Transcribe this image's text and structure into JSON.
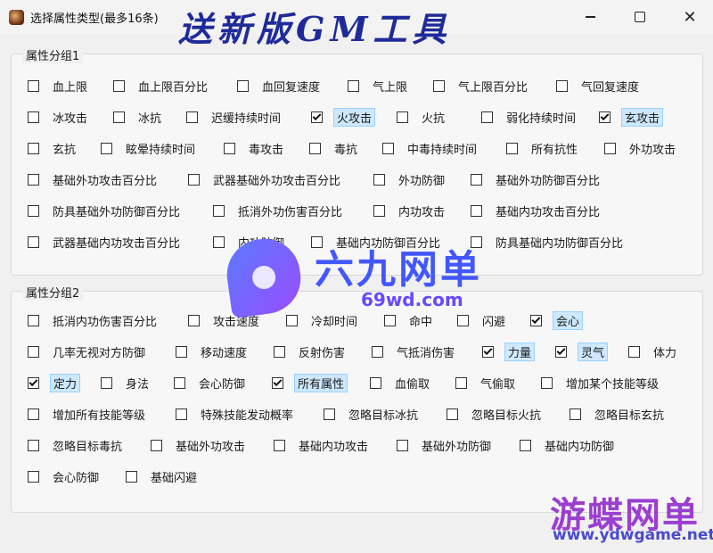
{
  "window": {
    "title": "选择属性类型(最多16条)",
    "banner": "送新版GM工具",
    "controls": {
      "minimize": "minimize-icon",
      "maximize": "maximize-icon",
      "close": "✕"
    }
  },
  "group1": {
    "legend": "属性分组1",
    "items": [
      {
        "label": "血上限",
        "checked": false
      },
      {
        "label": "血上限百分比",
        "checked": false
      },
      {
        "label": "血回复速度",
        "checked": false
      },
      {
        "label": "气上限",
        "checked": false
      },
      {
        "label": "气上限百分比",
        "checked": false
      },
      {
        "label": "气回复速度",
        "checked": false
      },
      {
        "label": "冰攻击",
        "checked": false
      },
      {
        "label": "冰抗",
        "checked": false
      },
      {
        "label": "迟缓持续时间",
        "checked": false
      },
      {
        "label": "火攻击",
        "checked": true
      },
      {
        "label": "火抗",
        "checked": false
      },
      {
        "label": "弱化持续时间",
        "checked": false
      },
      {
        "label": "玄攻击",
        "checked": true
      },
      {
        "label": "玄抗",
        "checked": false
      },
      {
        "label": "眩晕持续时间",
        "checked": false
      },
      {
        "label": "毒攻击",
        "checked": false
      },
      {
        "label": "毒抗",
        "checked": false
      },
      {
        "label": "中毒持续时间",
        "checked": false
      },
      {
        "label": "所有抗性",
        "checked": false
      },
      {
        "label": "外功攻击",
        "checked": false
      },
      {
        "label": "基础外功攻击百分比",
        "checked": false
      },
      {
        "label": "武器基础外功攻击百分比",
        "checked": false
      },
      {
        "label": "外功防御",
        "checked": false
      },
      {
        "label": "基础外功防御百分比",
        "checked": false
      },
      {
        "label": "防具基础外功防御百分比",
        "checked": false
      },
      {
        "label": "抵消外功伤害百分比",
        "checked": false
      },
      {
        "label": "内功攻击",
        "checked": false
      },
      {
        "label": "基础内功攻击百分比",
        "checked": false
      },
      {
        "label": "武器基础内功攻击百分比",
        "checked": false
      },
      {
        "label": "内功防御",
        "checked": false
      },
      {
        "label": "基础内功防御百分比",
        "checked": false
      },
      {
        "label": "防具基础内功防御百分比",
        "checked": false
      }
    ]
  },
  "group2": {
    "legend": "属性分组2",
    "items": [
      {
        "label": "抵消内功伤害百分比",
        "checked": false
      },
      {
        "label": "攻击速度",
        "checked": false
      },
      {
        "label": "冷却时间",
        "checked": false
      },
      {
        "label": "命中",
        "checked": false
      },
      {
        "label": "闪避",
        "checked": false
      },
      {
        "label": "会心",
        "checked": true
      },
      {
        "label": "几率无视对方防御",
        "checked": false
      },
      {
        "label": "移动速度",
        "checked": false
      },
      {
        "label": "反射伤害",
        "checked": false
      },
      {
        "label": "气抵消伤害",
        "checked": false
      },
      {
        "label": "力量",
        "checked": true
      },
      {
        "label": "灵气",
        "checked": true
      },
      {
        "label": "体力",
        "checked": false
      },
      {
        "label": "定力",
        "checked": true
      },
      {
        "label": "身法",
        "checked": false
      },
      {
        "label": "会心防御",
        "checked": false
      },
      {
        "label": "所有属性",
        "checked": true
      },
      {
        "label": "血偷取",
        "checked": false
      },
      {
        "label": "气偷取",
        "checked": false
      },
      {
        "label": "增加某个技能等级",
        "checked": false
      },
      {
        "label": "增加所有技能等级",
        "checked": false
      },
      {
        "label": "特殊技能发动概率",
        "checked": false
      },
      {
        "label": "忽略目标冰抗",
        "checked": false
      },
      {
        "label": "忽略目标火抗",
        "checked": false
      },
      {
        "label": "忽略目标玄抗",
        "checked": false
      },
      {
        "label": "忽略目标毒抗",
        "checked": false
      },
      {
        "label": "基础外功攻击",
        "checked": false
      },
      {
        "label": "基础内功攻击",
        "checked": false
      },
      {
        "label": "基础外功防御",
        "checked": false
      },
      {
        "label": "基础内功防御",
        "checked": false
      },
      {
        "label": "会心防御",
        "checked": false
      },
      {
        "label": "基础闪避",
        "checked": false
      }
    ]
  },
  "watermarks": {
    "brand1": "六九网单",
    "url1": "69wd.com",
    "brand2": "游蝶网单",
    "url2": "www.ydwgame.net"
  }
}
